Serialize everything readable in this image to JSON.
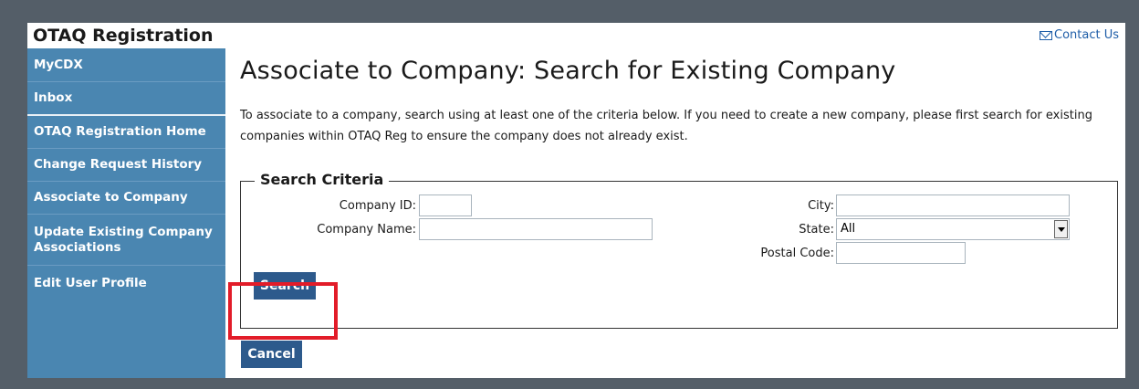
{
  "header": {
    "app_title": "OTAQ Registration",
    "contact_label": "Contact Us"
  },
  "sidebar": {
    "items": [
      {
        "label": "MyCDX"
      },
      {
        "label": "Inbox"
      },
      {
        "label": "OTAQ Registration Home"
      },
      {
        "label": "Change Request History"
      },
      {
        "label": "Associate to Company"
      },
      {
        "label": "Update Existing Company Associations"
      },
      {
        "label": "Edit User Profile"
      }
    ]
  },
  "main": {
    "title": "Associate to Company: Search for Existing Company",
    "intro": "To associate to a company, search using at least one of the criteria below. If you need to create a new company, please first search for existing companies within OTAQ Reg to ensure the company does not already exist.",
    "criteria": {
      "legend": "Search Criteria",
      "company_id_label": "Company ID:",
      "company_id_value": "",
      "company_name_label": "Company Name:",
      "company_name_value": "",
      "city_label": "City:",
      "city_value": "",
      "state_label": "State:",
      "state_value": "All",
      "postal_code_label": "Postal Code:",
      "postal_code_value": ""
    },
    "search_button": "Search",
    "cancel_button": "Cancel"
  },
  "colors": {
    "sidebar_bg": "#4a86b1",
    "button_bg": "#2d5a8c",
    "highlight": "#e21c29",
    "link": "#1f5ea8"
  },
  "icons": {
    "contact": "envelope-icon",
    "select": "chevron-down-icon"
  }
}
